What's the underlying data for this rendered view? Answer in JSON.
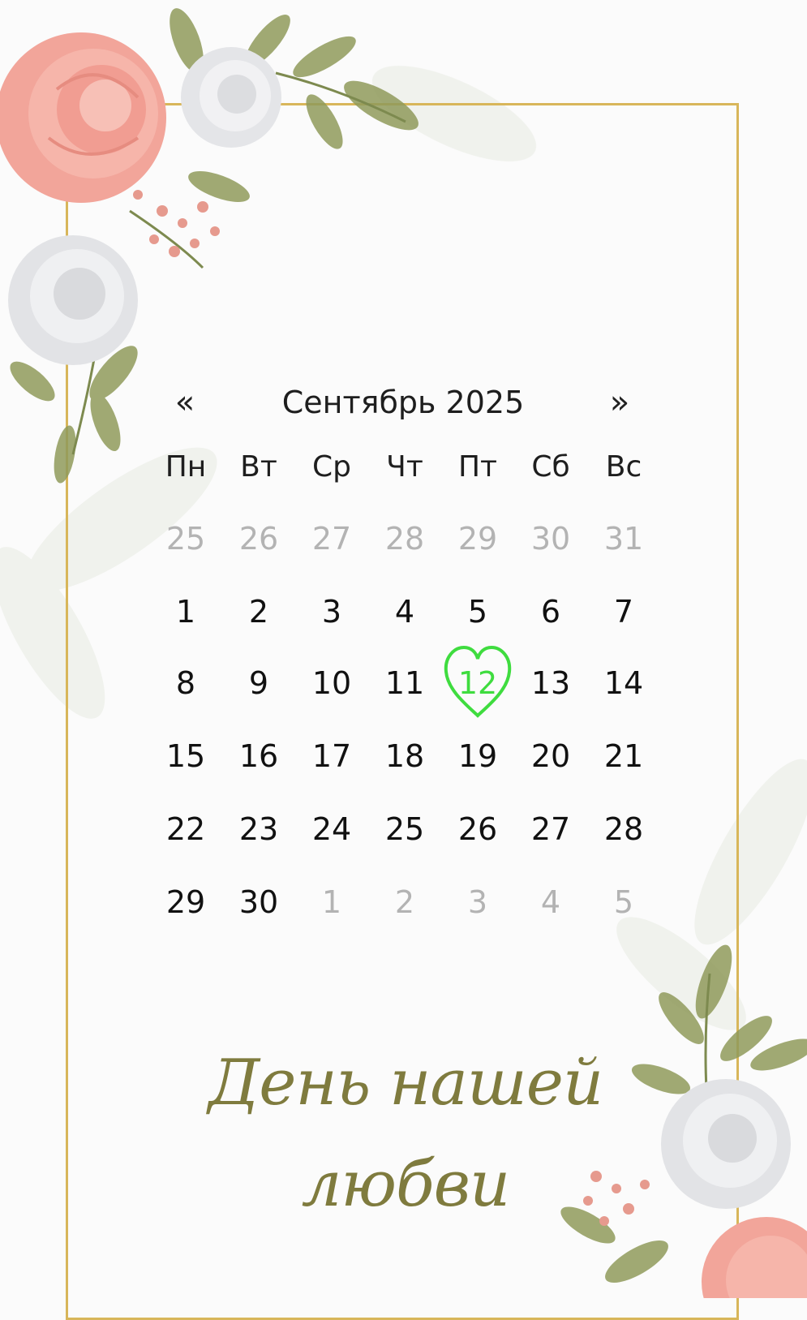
{
  "calendar": {
    "prev_symbol": "«",
    "next_symbol": "»",
    "month_title": "Сентябрь 2025",
    "weekdays": [
      "Пн",
      "Вт",
      "Ср",
      "Чт",
      "Пт",
      "Сб",
      "Вс"
    ],
    "weeks": [
      [
        {
          "d": "25",
          "m": true
        },
        {
          "d": "26",
          "m": true
        },
        {
          "d": "27",
          "m": true
        },
        {
          "d": "28",
          "m": true
        },
        {
          "d": "29",
          "m": true
        },
        {
          "d": "30",
          "m": true
        },
        {
          "d": "31",
          "m": true
        }
      ],
      [
        {
          "d": "1"
        },
        {
          "d": "2"
        },
        {
          "d": "3"
        },
        {
          "d": "4"
        },
        {
          "d": "5"
        },
        {
          "d": "6"
        },
        {
          "d": "7"
        }
      ],
      [
        {
          "d": "8"
        },
        {
          "d": "9"
        },
        {
          "d": "10"
        },
        {
          "d": "11"
        },
        {
          "d": "12",
          "sel": true
        },
        {
          "d": "13"
        },
        {
          "d": "14"
        }
      ],
      [
        {
          "d": "15"
        },
        {
          "d": "16"
        },
        {
          "d": "17"
        },
        {
          "d": "18"
        },
        {
          "d": "19"
        },
        {
          "d": "20"
        },
        {
          "d": "21"
        }
      ],
      [
        {
          "d": "22"
        },
        {
          "d": "23"
        },
        {
          "d": "24"
        },
        {
          "d": "25"
        },
        {
          "d": "26"
        },
        {
          "d": "27"
        },
        {
          "d": "28"
        }
      ],
      [
        {
          "d": "29"
        },
        {
          "d": "30"
        },
        {
          "d": "1",
          "m": true
        },
        {
          "d": "2",
          "m": true
        },
        {
          "d": "3",
          "m": true
        },
        {
          "d": "4",
          "m": true
        },
        {
          "d": "5",
          "m": true
        }
      ]
    ],
    "selected_marker": "heart-icon"
  },
  "tagline": {
    "line1": "День нашей",
    "line2": "любви"
  },
  "colors": {
    "frame": "#d8b65a",
    "selected": "#3fdc3f",
    "tagline": "#7f7b3e",
    "muted": "#b3b3b3"
  },
  "decorations": [
    "rose-bouquet-top-left",
    "rose-bouquet-bottom-right"
  ]
}
